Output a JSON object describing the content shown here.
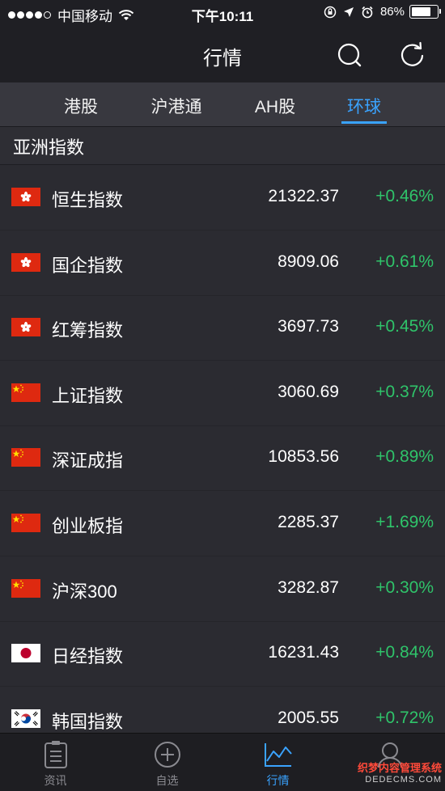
{
  "status_bar": {
    "carrier": "中国移动",
    "time": "下午10:11",
    "battery_text": "86%",
    "battery_level": 0.86,
    "icons": [
      "wifi-icon",
      "rotation-lock-icon",
      "location-icon",
      "alarm-icon",
      "battery-icon"
    ]
  },
  "nav": {
    "title": "行情",
    "search_icon": "search-icon",
    "refresh_icon": "refresh-icon"
  },
  "tabs": [
    {
      "label": "港股",
      "active": false
    },
    {
      "label": "沪港通",
      "active": false
    },
    {
      "label": "AH股",
      "active": false
    },
    {
      "label": "环球",
      "active": true
    }
  ],
  "section": {
    "title": "亚洲指数"
  },
  "indices": [
    {
      "flag": "hong-kong-flag-icon",
      "name": "恒生指数",
      "price": "21322.37",
      "change": "+0.46%"
    },
    {
      "flag": "hong-kong-flag-icon",
      "name": "国企指数",
      "price": "8909.06",
      "change": "+0.61%"
    },
    {
      "flag": "hong-kong-flag-icon",
      "name": "红筹指数",
      "price": "3697.73",
      "change": "+0.45%"
    },
    {
      "flag": "china-flag-icon",
      "name": "上证指数",
      "price": "3060.69",
      "change": "+0.37%"
    },
    {
      "flag": "china-flag-icon",
      "name": "深证成指",
      "price": "10853.56",
      "change": "+0.89%"
    },
    {
      "flag": "china-flag-icon",
      "name": "创业板指",
      "price": "2285.37",
      "change": "+1.69%"
    },
    {
      "flag": "china-flag-icon",
      "name": "沪深300",
      "price": "3282.87",
      "change": "+0.30%"
    },
    {
      "flag": "japan-flag-icon",
      "name": "日经指数",
      "price": "16231.43",
      "change": "+0.84%"
    },
    {
      "flag": "korea-flag-icon",
      "name": "韩国指数",
      "price": "2005.55",
      "change": "+0.72%"
    }
  ],
  "tabbar": [
    {
      "label": "资讯",
      "icon": "news-icon",
      "active": false
    },
    {
      "label": "自选",
      "icon": "add-watchlist-icon",
      "active": false
    },
    {
      "label": "行情",
      "icon": "market-chart-icon",
      "active": true
    },
    {
      "label": "",
      "icon": "profile-icon",
      "active": false
    }
  ],
  "watermark": {
    "line1": "织梦内容管理系统",
    "line2": "DEDECMS.COM"
  },
  "colors": {
    "background": "#2b2b31",
    "header": "#1f1f24",
    "accent": "#3aa3ff",
    "positive": "#2fc46a"
  }
}
